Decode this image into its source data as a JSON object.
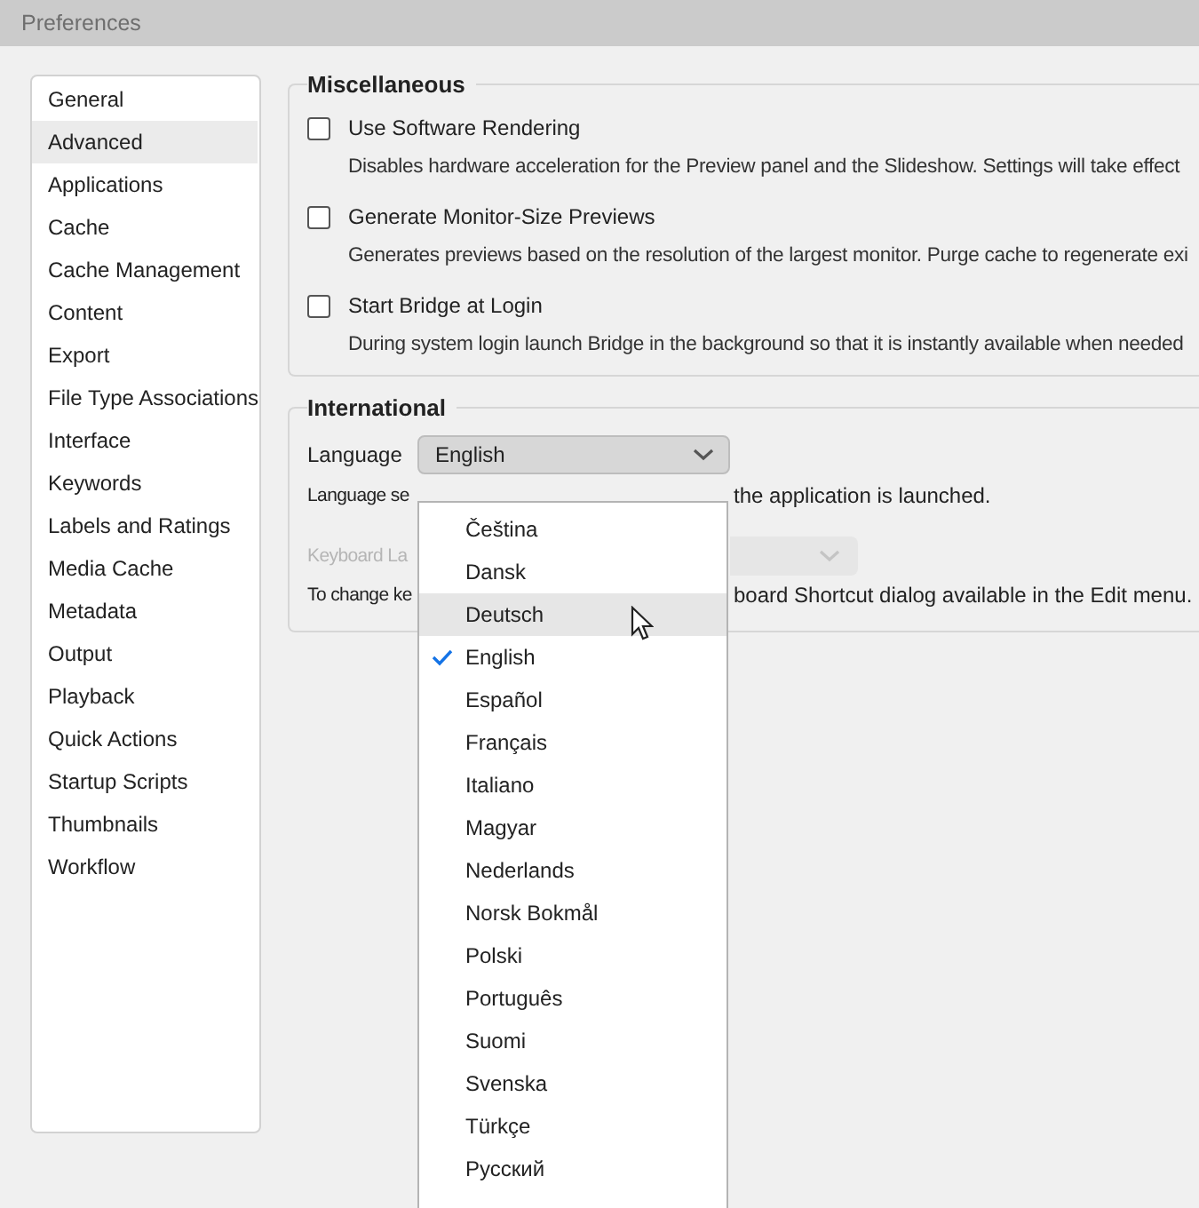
{
  "window": {
    "title": "Preferences"
  },
  "sidebar": {
    "items": [
      {
        "label": "General",
        "selected": false
      },
      {
        "label": "Advanced",
        "selected": true
      },
      {
        "label": "Applications",
        "selected": false
      },
      {
        "label": "Cache",
        "selected": false
      },
      {
        "label": "Cache Management",
        "selected": false
      },
      {
        "label": "Content",
        "selected": false
      },
      {
        "label": "Export",
        "selected": false
      },
      {
        "label": "File Type Associations",
        "selected": false
      },
      {
        "label": "Interface",
        "selected": false
      },
      {
        "label": "Keywords",
        "selected": false
      },
      {
        "label": "Labels and Ratings",
        "selected": false
      },
      {
        "label": "Media Cache",
        "selected": false
      },
      {
        "label": "Metadata",
        "selected": false
      },
      {
        "label": "Output",
        "selected": false
      },
      {
        "label": "Playback",
        "selected": false
      },
      {
        "label": "Quick Actions",
        "selected": false
      },
      {
        "label": "Startup Scripts",
        "selected": false
      },
      {
        "label": "Thumbnails",
        "selected": false
      },
      {
        "label": "Workflow",
        "selected": false
      }
    ]
  },
  "miscellaneous": {
    "title": "Miscellaneous",
    "options": [
      {
        "label": "Use Software Rendering",
        "checked": false,
        "description": "Disables hardware acceleration for the Preview panel and the Slideshow. Settings will take effect"
      },
      {
        "label": "Generate Monitor-Size Previews",
        "checked": false,
        "description": "Generates previews based on the resolution of the largest monitor.  Purge cache to regenerate exi"
      },
      {
        "label": "Start Bridge at Login",
        "checked": false,
        "description": "During system login launch Bridge in the background so that it is instantly available when needed"
      }
    ]
  },
  "international": {
    "title": "International",
    "language": {
      "label": "Language",
      "value": "English",
      "note_start": "Language se",
      "note_end": "the application is launched."
    },
    "keyboard": {
      "label": "Keyboard La",
      "disabled": true,
      "note_start": "To change ke",
      "note_end": "board Shortcut dialog available in the Edit menu."
    }
  },
  "language_menu": {
    "items": [
      {
        "label": "Čeština",
        "selected": false,
        "hovered": false
      },
      {
        "label": "Dansk",
        "selected": false,
        "hovered": false
      },
      {
        "label": "Deutsch",
        "selected": false,
        "hovered": true
      },
      {
        "label": "English",
        "selected": true,
        "hovered": false
      },
      {
        "label": "Español",
        "selected": false,
        "hovered": false
      },
      {
        "label": "Français",
        "selected": false,
        "hovered": false
      },
      {
        "label": "Italiano",
        "selected": false,
        "hovered": false
      },
      {
        "label": "Magyar",
        "selected": false,
        "hovered": false
      },
      {
        "label": "Nederlands",
        "selected": false,
        "hovered": false
      },
      {
        "label": "Norsk Bokmål",
        "selected": false,
        "hovered": false
      },
      {
        "label": "Polski",
        "selected": false,
        "hovered": false
      },
      {
        "label": "Português",
        "selected": false,
        "hovered": false
      },
      {
        "label": "Suomi",
        "selected": false,
        "hovered": false
      },
      {
        "label": "Svenska",
        "selected": false,
        "hovered": false
      },
      {
        "label": "Türkçe",
        "selected": false,
        "hovered": false
      },
      {
        "label": "Русский",
        "selected": false,
        "hovered": false
      }
    ]
  }
}
